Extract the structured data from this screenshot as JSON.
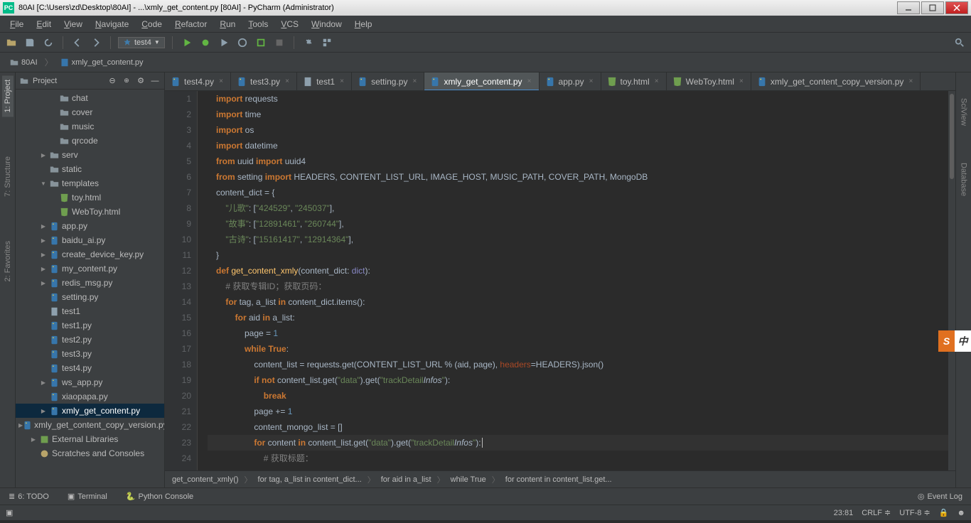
{
  "window": {
    "title": "80AI [C:\\Users\\zd\\Desktop\\80AI] - ...\\xmly_get_content.py [80AI] - PyCharm (Administrator)"
  },
  "menu": [
    "File",
    "Edit",
    "View",
    "Navigate",
    "Code",
    "Refactor",
    "Run",
    "Tools",
    "VCS",
    "Window",
    "Help"
  ],
  "run_config": "test4",
  "nav_crumbs": [
    "80AI",
    "xmly_get_content.py"
  ],
  "left_tool_tabs": [
    "1: Project",
    "7: Structure",
    "2: Favorites"
  ],
  "right_tool_tabs": [
    "SciView",
    "Database"
  ],
  "project_panel": {
    "title": "Project",
    "nodes": [
      {
        "depth": 3,
        "arrow": "",
        "icon": "folder",
        "label": "chat"
      },
      {
        "depth": 3,
        "arrow": "",
        "icon": "folder",
        "label": "cover"
      },
      {
        "depth": 3,
        "arrow": "",
        "icon": "folder",
        "label": "music"
      },
      {
        "depth": 3,
        "arrow": "",
        "icon": "folder",
        "label": "qrcode"
      },
      {
        "depth": 2,
        "arrow": "▶",
        "icon": "folder",
        "label": "serv"
      },
      {
        "depth": 2,
        "arrow": "",
        "icon": "folder",
        "label": "static"
      },
      {
        "depth": 2,
        "arrow": "▼",
        "icon": "folder",
        "label": "templates"
      },
      {
        "depth": 3,
        "arrow": "",
        "icon": "html",
        "label": "toy.html"
      },
      {
        "depth": 3,
        "arrow": "",
        "icon": "html",
        "label": "WebToy.html"
      },
      {
        "depth": 2,
        "arrow": "▶",
        "icon": "py",
        "label": "app.py"
      },
      {
        "depth": 2,
        "arrow": "▶",
        "icon": "py",
        "label": "baidu_ai.py"
      },
      {
        "depth": 2,
        "arrow": "▶",
        "icon": "py",
        "label": "create_device_key.py"
      },
      {
        "depth": 2,
        "arrow": "▶",
        "icon": "py",
        "label": "my_content.py"
      },
      {
        "depth": 2,
        "arrow": "▶",
        "icon": "py",
        "label": "redis_msg.py"
      },
      {
        "depth": 2,
        "arrow": "",
        "icon": "py",
        "label": "setting.py"
      },
      {
        "depth": 2,
        "arrow": "",
        "icon": "file",
        "label": "test1"
      },
      {
        "depth": 2,
        "arrow": "",
        "icon": "py",
        "label": "test1.py"
      },
      {
        "depth": 2,
        "arrow": "",
        "icon": "py",
        "label": "test2.py"
      },
      {
        "depth": 2,
        "arrow": "",
        "icon": "py",
        "label": "test3.py"
      },
      {
        "depth": 2,
        "arrow": "",
        "icon": "py",
        "label": "test4.py"
      },
      {
        "depth": 2,
        "arrow": "▶",
        "icon": "py",
        "label": "ws_app.py"
      },
      {
        "depth": 2,
        "arrow": "",
        "icon": "py",
        "label": "xiaopapa.py"
      },
      {
        "depth": 2,
        "arrow": "▶",
        "icon": "py",
        "label": "xmly_get_content.py",
        "selected": true
      },
      {
        "depth": 2,
        "arrow": "▶",
        "icon": "py",
        "label": "xmly_get_content_copy_version.py"
      },
      {
        "depth": 1,
        "arrow": "▶",
        "icon": "lib",
        "label": "External Libraries"
      },
      {
        "depth": 1,
        "arrow": "",
        "icon": "scratch",
        "label": "Scratches and Consoles"
      }
    ]
  },
  "editor_tabs": [
    {
      "icon": "py",
      "label": "test4.py"
    },
    {
      "icon": "py",
      "label": "test3.py"
    },
    {
      "icon": "file",
      "label": "test1"
    },
    {
      "icon": "py",
      "label": "setting.py"
    },
    {
      "icon": "py",
      "label": "xmly_get_content.py",
      "active": true
    },
    {
      "icon": "py",
      "label": "app.py"
    },
    {
      "icon": "html",
      "label": "toy.html"
    },
    {
      "icon": "html",
      "label": "WebToy.html"
    },
    {
      "icon": "py",
      "label": "xmly_get_content_copy_version.py"
    }
  ],
  "code_lines": [
    {
      "n": 1,
      "html": "<span class='kw'>import</span> requests"
    },
    {
      "n": 2,
      "html": "<span class='kw'>import</span> time"
    },
    {
      "n": 3,
      "html": "<span class='kw'>import</span> os"
    },
    {
      "n": 4,
      "html": "<span class='kw'>import</span> datetime"
    },
    {
      "n": 5,
      "html": "<span class='kw'>from</span> uuid <span class='kw'>import</span> uuid4"
    },
    {
      "n": 6,
      "html": "<span class='kw'>from</span> setting <span class='kw'>import</span> HEADERS, CONTENT_LIST_URL, IMAGE_HOST, MUSIC_PATH, COVER_PATH, MongoDB"
    },
    {
      "n": 7,
      "html": "content_dict = {"
    },
    {
      "n": 8,
      "html": "    <span class='str'>\"儿歌\"</span>: [<span class='str'>\"424529\"</span>, <span class='str'>\"245037\"</span>],"
    },
    {
      "n": 9,
      "html": "    <span class='str'>\"故事\"</span>: [<span class='str'>\"12891461\"</span>, <span class='str'>\"260744\"</span>],"
    },
    {
      "n": 10,
      "html": "    <span class='str'>\"古诗\"</span>: [<span class='str'>\"15161417\"</span>, <span class='str'>\"12914364\"</span>],"
    },
    {
      "n": 11,
      "html": "}"
    },
    {
      "n": 12,
      "html": "<span class='kw'>def</span> <span class='fn'>get_content_xmly</span>(content_dict: <span class='typ'>dict</span>):"
    },
    {
      "n": 13,
      "html": "    <span class='cmt'># 获取专辑ID；获取页码：</span>"
    },
    {
      "n": 14,
      "html": "    <span class='kw'>for</span> tag, a_list <span class='kw'>in</span> content_dict.items():"
    },
    {
      "n": 15,
      "html": "        <span class='kw'>for</span> aid <span class='kw'>in</span> a_list:"
    },
    {
      "n": 16,
      "html": "            page = <span class='num'>1</span>"
    },
    {
      "n": 17,
      "html": "            <span class='kw'>while</span> <span class='kw'>True</span>:"
    },
    {
      "n": 18,
      "html": "                content_list = requests.get(CONTENT_LIST_URL % (aid, page), <span class='named'>headers</span>=HEADERS).json()"
    },
    {
      "n": 19,
      "html": "                <span class='kw'>if</span> <span class='kw'>not</span> content_list.get(<span class='str'>\"data\"</span>).get(<span class='str'>\"trackDetail<span class='typItal'>Infos</span>\"</span>):"
    },
    {
      "n": 20,
      "html": "                    <span class='kw'>break</span>"
    },
    {
      "n": 21,
      "html": "                page += <span class='num'>1</span>"
    },
    {
      "n": 22,
      "html": "                content_mongo_list = []"
    },
    {
      "n": 23,
      "html": "                <span class='kw'>for</span> content <span class='kw'>in</span> content_list.get(<span class='str'>\"data\"</span>).get(<span class='str'>\"trackDetail<span class='typItal'>Infos</span>\"</span>):",
      "cursor": true
    },
    {
      "n": 24,
      "html": "                    <span class='cmt'># 获取标题：</span>"
    }
  ],
  "breadcrumbs": [
    "get_content_xmly()",
    "for tag, a_list in content_dict...",
    "for aid in a_list",
    "while True",
    "for content in content_list.get..."
  ],
  "tool_windows": {
    "items": [
      "6: TODO",
      "Terminal",
      "Python Console"
    ],
    "right": "Event Log"
  },
  "status": {
    "position": "23:81",
    "line_ending": "CRLF",
    "encoding": "UTF-8"
  },
  "ime": {
    "a": "S",
    "b": "中"
  }
}
